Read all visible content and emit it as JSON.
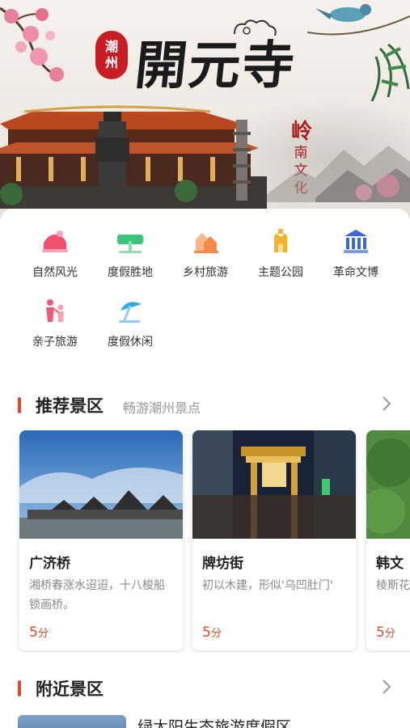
{
  "banner": {
    "seal_text": [
      "潮",
      "州"
    ],
    "title": "開元寺",
    "side_text": [
      "岭",
      "南",
      "文",
      "化"
    ]
  },
  "categories": [
    {
      "label": "自然风光",
      "icon": "mountain-icon",
      "color": "#f0506e"
    },
    {
      "label": "度假胜地",
      "icon": "palm-tree-icon",
      "color": "#3cc47c"
    },
    {
      "label": "乡村旅游",
      "icon": "village-icon",
      "color": "#f5894a"
    },
    {
      "label": "主题公园",
      "icon": "castle-icon",
      "color": "#f5b22a"
    },
    {
      "label": "革命文博",
      "icon": "museum-icon",
      "color": "#3a67d8"
    },
    {
      "label": "亲子旅游",
      "icon": "family-icon",
      "color": "#f05a78"
    },
    {
      "label": "度假休闲",
      "icon": "beach-umbrella-icon",
      "color": "#35a8e0"
    }
  ],
  "recommended": {
    "title": "推荐景区",
    "subtitle": "畅游潮州景点",
    "cards": [
      {
        "name": "广济桥",
        "desc": "湘桥春涨水迢迢，十八梭船锁画桥。",
        "score": "5",
        "unit": "分"
      },
      {
        "name": "牌坊街",
        "desc": "初以木建，形似'乌凹肚门'",
        "score": "5",
        "unit": "分"
      },
      {
        "name": "韩文",
        "desc": "棱斯花",
        "score": "5",
        "unit": "分"
      }
    ]
  },
  "nearby": {
    "title": "附近景区",
    "first_item_title": "绿太阳生态旅游度假区"
  }
}
